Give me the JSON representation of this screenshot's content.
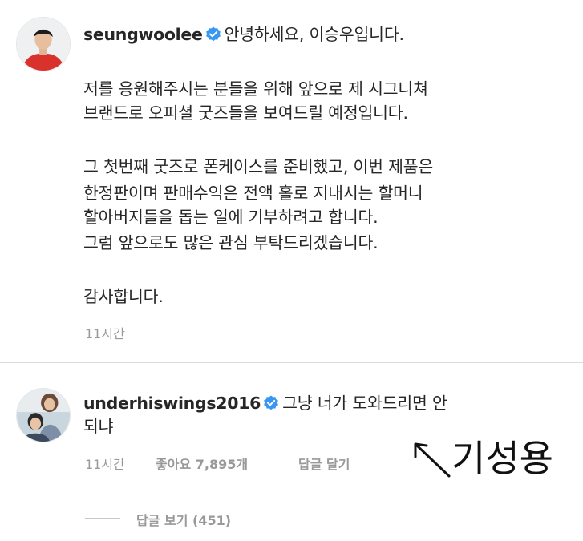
{
  "post": {
    "username": "seungwoolee",
    "verified": true,
    "first_line": "안녕하세요, 이승우입니다.",
    "lines": [
      "저를 응원해주시는 분들을 위해 앞으로 제 시그니쳐",
      "브랜드로 오피셜 굿즈들을 보여드릴 예정입니다.",
      "그 첫번째 굿즈로 폰케이스를 준비했고, 이번 제품은",
      "한정판이며 판매수익은 전액 홀로 지내시는 할머니",
      "할아버지들을 돕는 일에 기부하려고 합니다.",
      "그럼 앞으로도 많은 관심 부탁드리겠습니다.",
      "감사합니다."
    ],
    "time": "11시간"
  },
  "comment": {
    "username": "underhiswings2016",
    "verified": true,
    "first_line": "그냥 너가 도와드리면 안",
    "second_line": "되냐",
    "time": "11시간",
    "likes": "좋아요 7,895개",
    "reply": "답글 달기",
    "view_replies": "답글 보기 (451)"
  },
  "annotation": {
    "text": "기성용"
  },
  "colors": {
    "text": "#262626",
    "meta": "#999999",
    "verified_badge": "#3897f0"
  },
  "icons": {
    "verified": "verified-badge-icon",
    "annotation_arrow": "arrow-icon"
  }
}
